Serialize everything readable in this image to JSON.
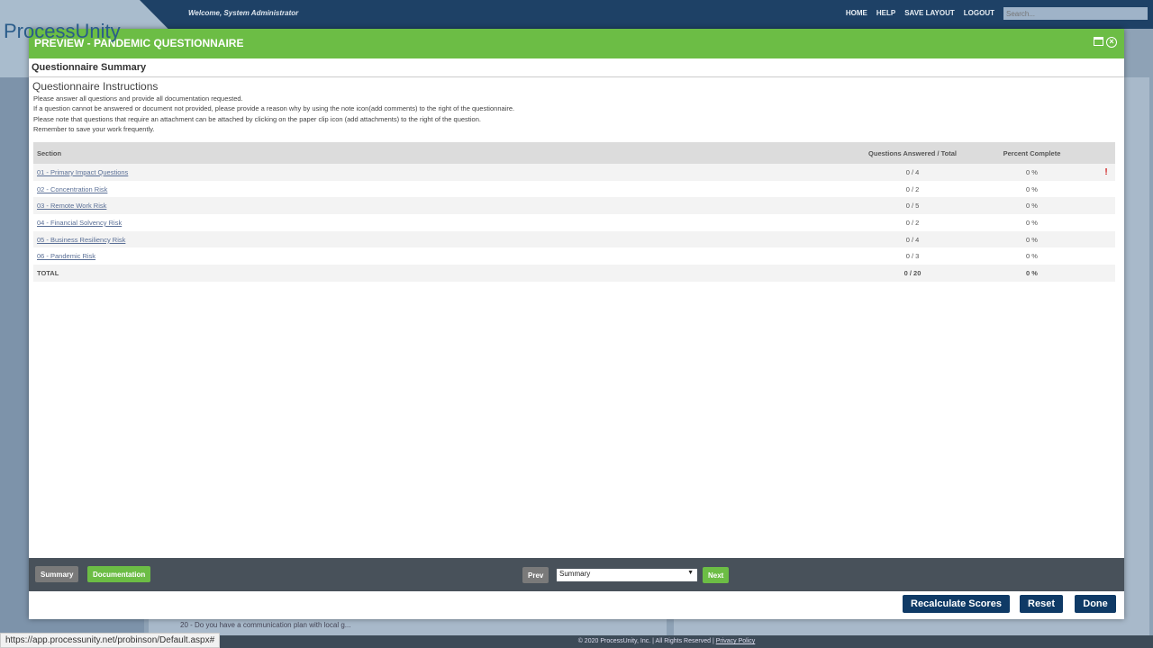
{
  "app": {
    "logo": "ProcessUnity",
    "welcome": "Welcome,  System Administrator",
    "nav": [
      "HOME",
      "HELP",
      "SAVE LAYOUT",
      "LOGOUT"
    ],
    "search_placeholder": "Search...",
    "status_url": "https://app.processunity.net/probinson/Default.aspx#",
    "copyright": "© 2020 ProcessUnity, Inc.  |  All Rights Reserved  |",
    "privacy": "Privacy Policy",
    "bg_row": "20 - Do you have a communication plan with local g..."
  },
  "modal": {
    "title": "PREVIEW - PANDEMIC QUESTIONNAIRE",
    "summary_title": "Questionnaire Summary",
    "instructions_title": "Questionnaire Instructions",
    "instructions": [
      "Please answer all questions and provide all documentation requested.",
      "If a question cannot be answered or document not provided, please provide a reason why by using the note icon(add comments) to the right of the questionnaire.",
      "Please note that questions that require an attachment can be attached by clicking on the paper clip icon (add attachments) to the right of the question.",
      "Remember to save your work frequently."
    ]
  },
  "table": {
    "headers": {
      "section": "Section",
      "answered": "Questions Answered / Total",
      "percent": "Percent Complete"
    },
    "rows": [
      {
        "section": "01 - Primary Impact Questions",
        "answered": "0 / 4",
        "percent": "0 %",
        "flag": "!"
      },
      {
        "section": "02 - Concentration Risk",
        "answered": "0 / 2",
        "percent": "0 %"
      },
      {
        "section": "03 - Remote Work Risk",
        "answered": "0 / 5",
        "percent": "0 %"
      },
      {
        "section": "04 - Financial Solvency Risk",
        "answered": "0 / 2",
        "percent": "0 %"
      },
      {
        "section": "05 - Business Resiliency Risk",
        "answered": "0 / 4",
        "percent": "0 %"
      },
      {
        "section": "06 - Pandemic Risk",
        "answered": "0 / 3",
        "percent": "0 %"
      }
    ],
    "total": {
      "label": "TOTAL",
      "answered": "0 / 20",
      "percent": "0 %"
    }
  },
  "footer": {
    "summary": "Summary",
    "documentation": "Documentation",
    "prev": "Prev",
    "select_value": "Summary",
    "next": "Next",
    "recalculate": "Recalculate Scores",
    "reset": "Reset",
    "done": "Done"
  },
  "colors": {
    "header_green": "#6cbd45",
    "navy": "#0f3a66",
    "topbar": "#1e4166"
  }
}
